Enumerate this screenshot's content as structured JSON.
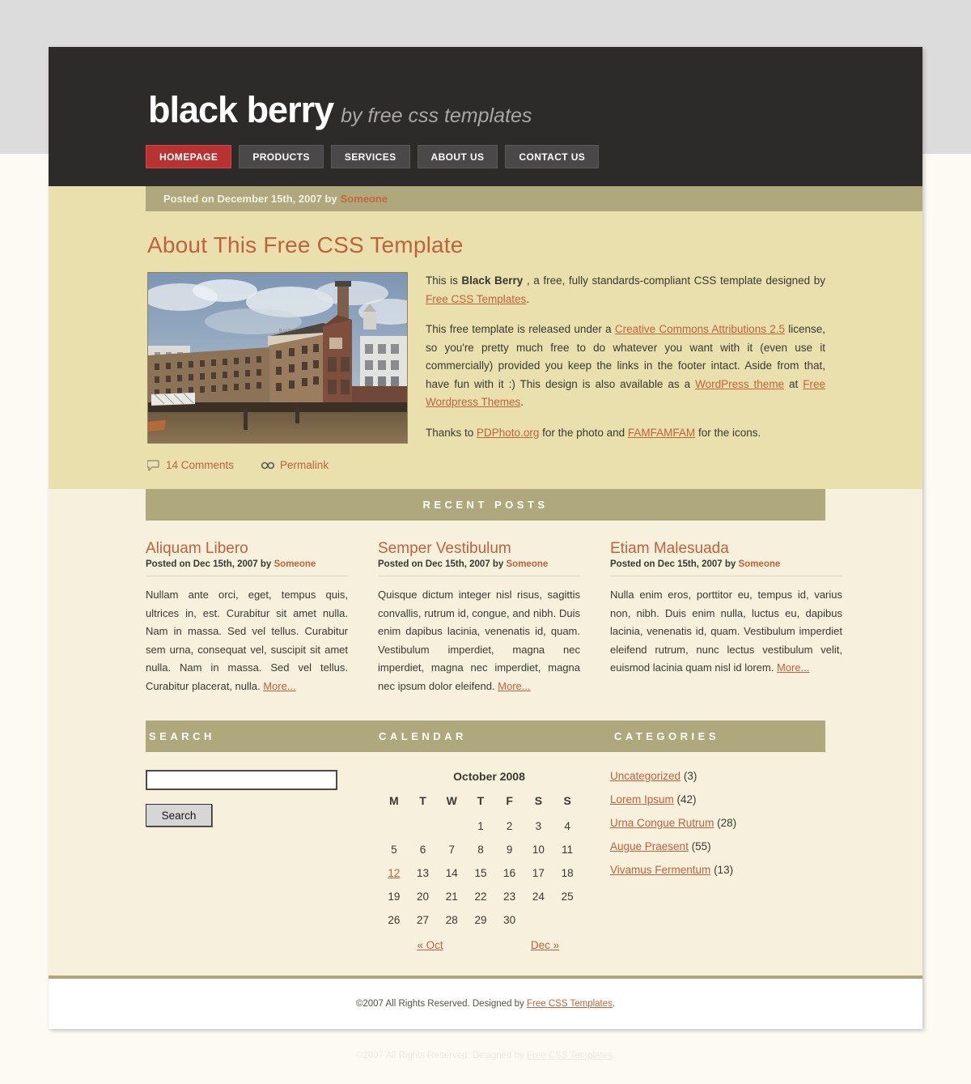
{
  "site": {
    "logo_main": "black berry",
    "logo_sub": "by free css templates"
  },
  "nav": {
    "items": [
      {
        "label": "HOMEPAGE",
        "active": true
      },
      {
        "label": "PRODUCTS",
        "active": false
      },
      {
        "label": "SERVICES",
        "active": false
      },
      {
        "label": "ABOUT US",
        "active": false
      },
      {
        "label": "CONTACT US",
        "active": false
      }
    ]
  },
  "featured": {
    "meta_prefix": "Posted on December 15th, 2007 by",
    "meta_author": "Someone",
    "title": "About This Free CSS Template",
    "photo_alt": "Butler's Wharf warehouse building on the River Thames",
    "para1_a": "This is ",
    "para1_bold": "Black Berry",
    "para1_b": " , a free, fully standards-compliant CSS template designed by ",
    "para1_link": "Free CSS Templates",
    "para1_c": ".",
    "para2_a": "This free template is released under a ",
    "para2_link1": "Creative Commons Attributions 2.5",
    "para2_b": " license, so you're pretty much free to do whatever you want with it (even use it commercially) provided you keep the links in the footer intact. Aside from that, have fun with it :) This design is also available as a ",
    "para2_link2": "WordPress theme",
    "para2_c": " at ",
    "para2_link3": "Free Wordpress Themes",
    "para2_d": ".",
    "para3_a": "Thanks to ",
    "para3_link1": "PDPhoto.org",
    "para3_b": " for the photo and ",
    "para3_link2": "FAMFAMFAM",
    "para3_c": " for the icons.",
    "comments_label": "14 Comments",
    "permalink_label": "Permalink"
  },
  "recent": {
    "section_title": "RECENT POSTS",
    "more_label": "More...",
    "posts": [
      {
        "title": "Aliquam Libero",
        "meta_prefix": "Posted on Dec 15th, 2007 by",
        "meta_author": "Someone",
        "body": "Nullam ante orci, eget, tempus quis, ultrices in, est. Curabitur sit amet nulla. Nam in massa. Sed vel tellus. Curabitur sem urna, consequat vel, suscipit sit amet nulla. Nam in massa. Sed vel tellus. Curabitur placerat, nulla. "
      },
      {
        "title": "Semper Vestibulum",
        "meta_prefix": "Posted on Dec 15th, 2007 by",
        "meta_author": "Someone",
        "body": "Quisque dictum integer nisl risus, sagittis convallis, rutrum id, congue, and nibh. Duis enim dapibus lacinia, venenatis id, quam. Vestibulum imperdiet, magna nec imperdiet, magna nec imperdiet, magna nec ipsum dolor eleifend. "
      },
      {
        "title": "Etiam Malesuada",
        "meta_prefix": "Posted on Dec 15th, 2007 by",
        "meta_author": "Someone",
        "body": "Nulla enim eros, porttitor eu, tempus id, varius non, nibh. Duis enim nulla, luctus eu, dapibus lacinia, venenatis id, quam. Vestibulum imperdiet eleifend rutrum, nunc lectus vestibulum velit, euismod lacinia quam nisl id lorem. "
      }
    ]
  },
  "widgets": {
    "search_title": "SEARCH",
    "calendar_title": "CALENDAR",
    "categories_title": "CATEGORIES",
    "search": {
      "value": "",
      "placeholder": "",
      "button_label": "Search"
    },
    "calendar": {
      "month_title": "October 2008",
      "weekdays": [
        "M",
        "T",
        "W",
        "T",
        "F",
        "S",
        "S"
      ],
      "weeks": [
        [
          "",
          "",
          "",
          "1",
          "2",
          "3",
          "4"
        ],
        [
          "5",
          "6",
          "7",
          "8",
          "9",
          "10",
          "11"
        ],
        [
          "12",
          "13",
          "14",
          "15",
          "16",
          "17",
          "18"
        ],
        [
          "19",
          "20",
          "21",
          "22",
          "23",
          "24",
          "25"
        ],
        [
          "26",
          "27",
          "28",
          "29",
          "30",
          "",
          ""
        ]
      ],
      "highlight_day": "12",
      "prev_label": "« Oct",
      "next_label": "Dec »"
    },
    "categories": [
      {
        "name": "Uncategorized",
        "count": "(3)"
      },
      {
        "name": "Lorem Ipsum",
        "count": "(42)"
      },
      {
        "name": "Urna Congue Rutrum",
        "count": "(28)"
      },
      {
        "name": "Augue Praesent",
        "count": "(55)"
      },
      {
        "name": "Vivamus Fermentum",
        "count": "(13)"
      }
    ]
  },
  "footer": {
    "text_prefix": "©2007 All Rights Reserved. Designed by ",
    "link": "Free CSS Templates",
    "text_suffix": "."
  },
  "colors": {
    "header_bg": "#2d2a2a",
    "accent_red": "#b93232",
    "accent_orange": "#c0623c",
    "featured_bg": "#e9e0ae",
    "lower_bg": "#f6f0dc",
    "bar_bg": "#b0a87d"
  }
}
